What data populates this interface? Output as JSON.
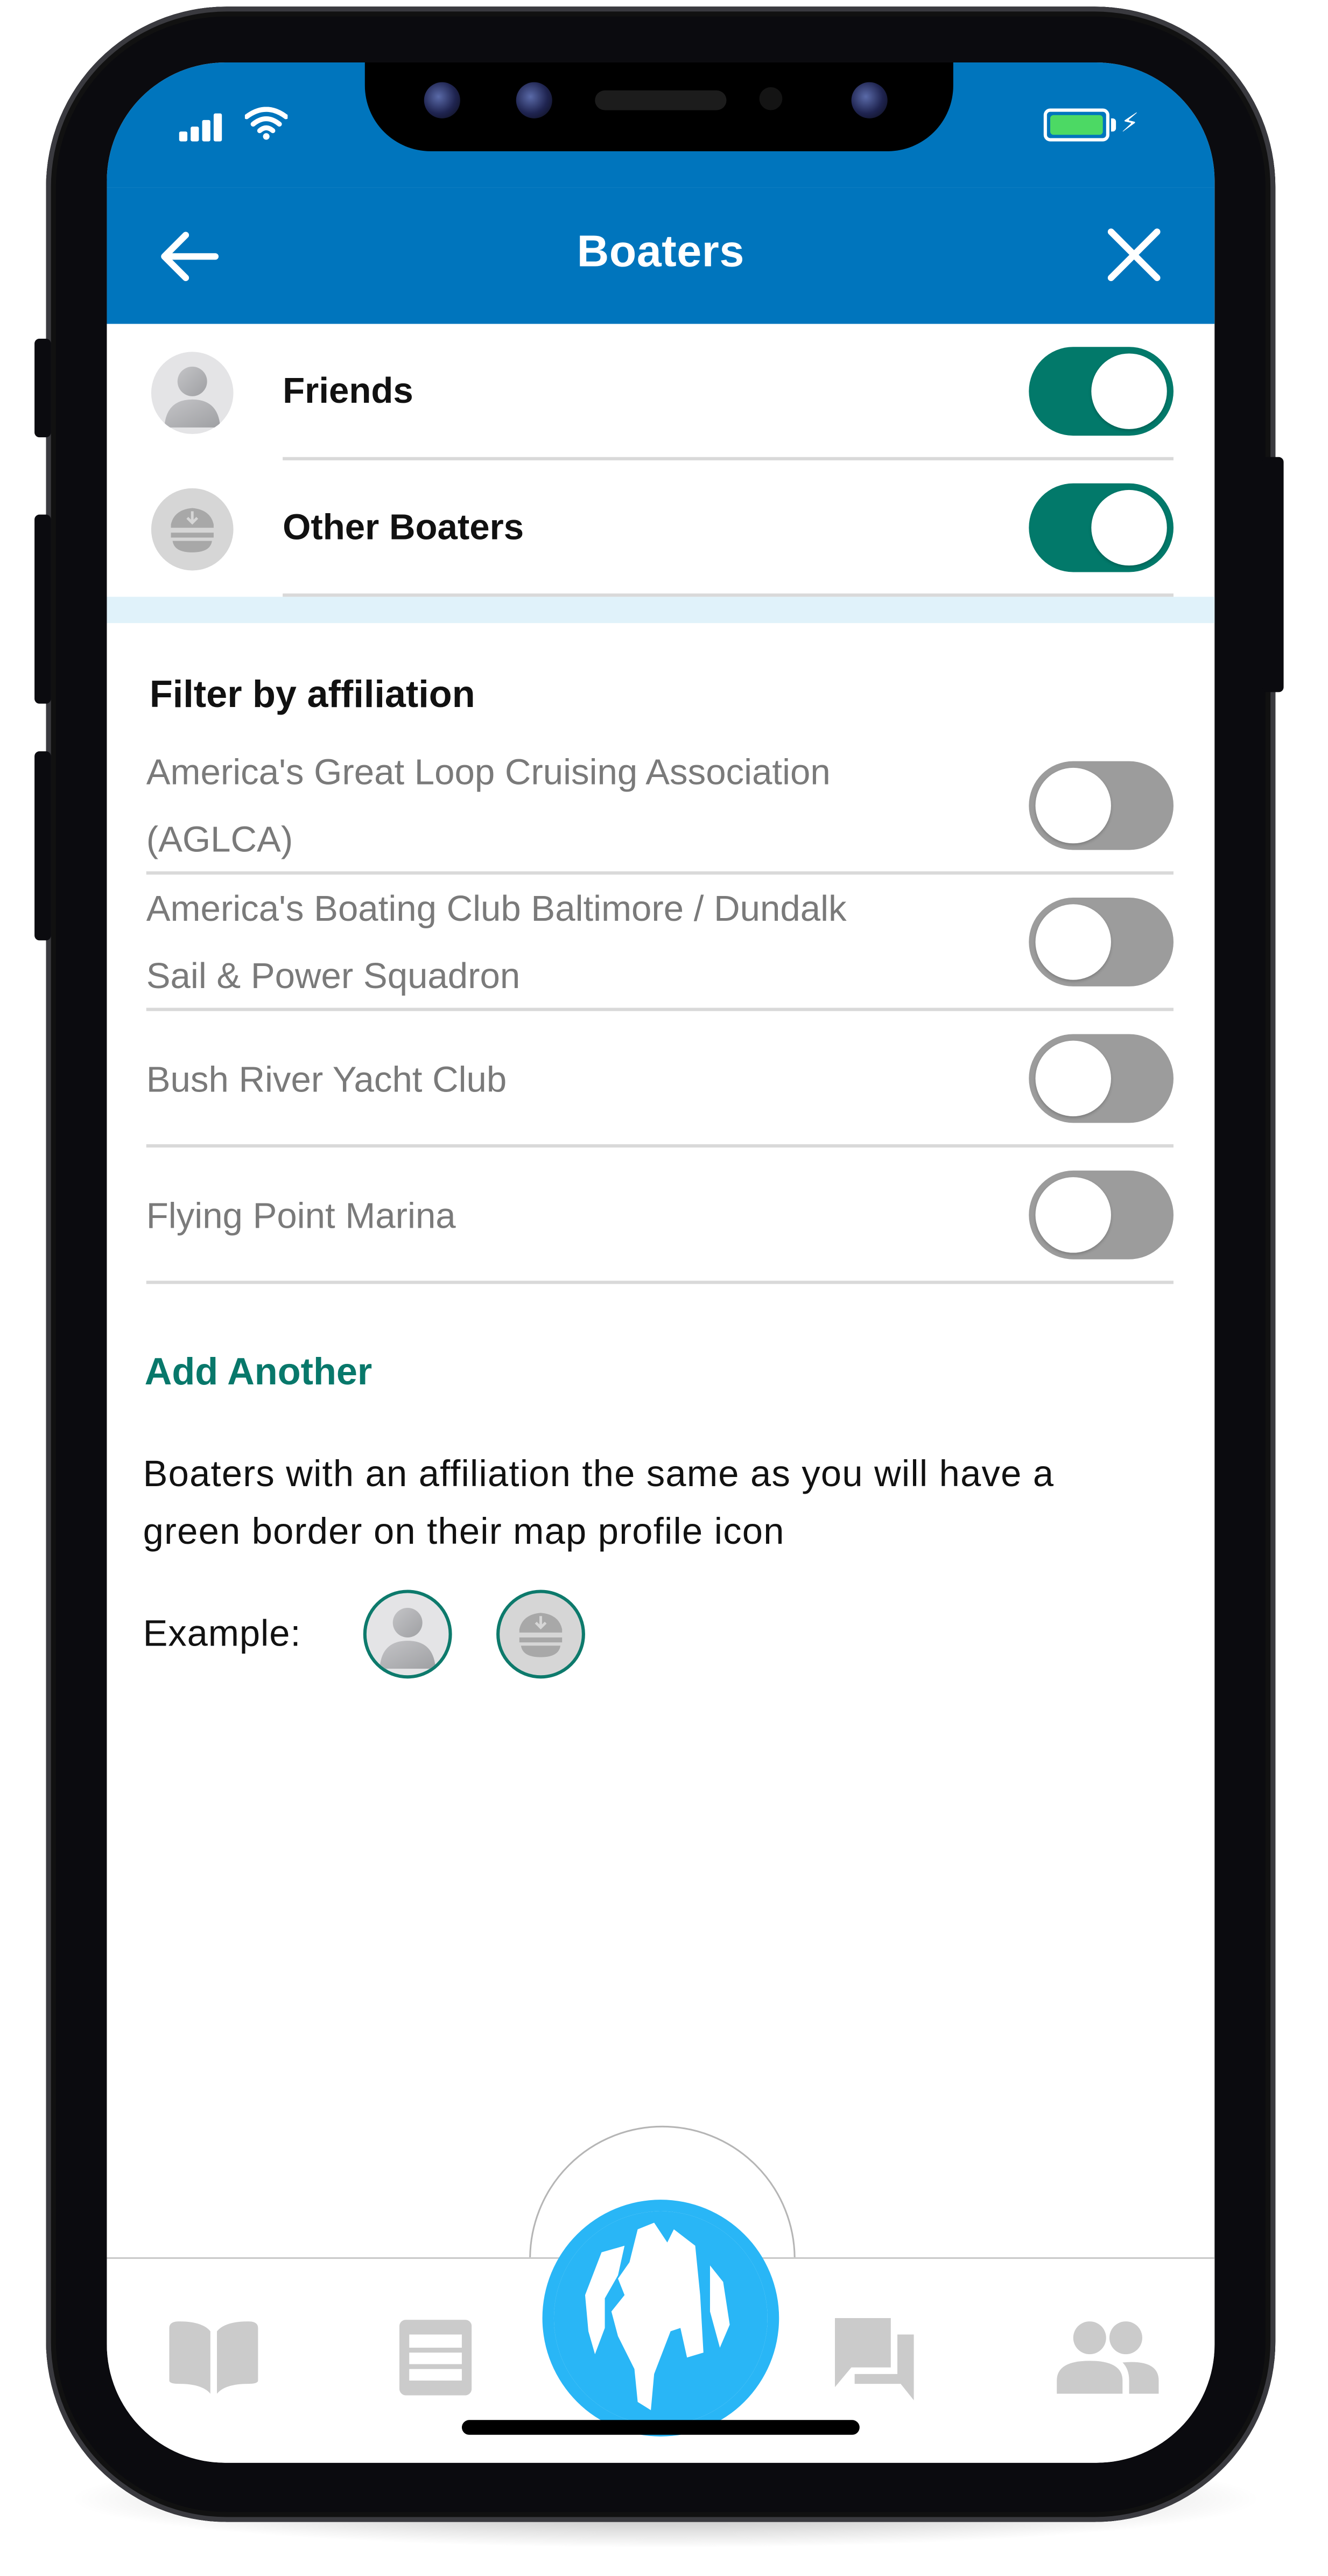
{
  "status_bar": {
    "signal_icon": "cellular-signal-icon",
    "wifi_icon": "wifi-icon",
    "battery_icon": "battery-charging-icon",
    "battery_level_percent": 100
  },
  "header": {
    "title": "Boaters",
    "back_icon": "arrow-left-icon",
    "close_icon": "close-icon",
    "background_color": "#0075bd"
  },
  "visibility": [
    {
      "label": "Friends",
      "icon": "person-avatar-icon",
      "enabled": true
    },
    {
      "label": "Other Boaters",
      "icon": "captain-hat-icon",
      "enabled": true
    }
  ],
  "affiliation": {
    "heading": "Filter by affiliation",
    "items": [
      {
        "line1": "America's Great Loop Cruising Association",
        "line2": "(AGLCA)",
        "enabled": false
      },
      {
        "line1": "America's Boating Club Baltimore / Dundalk",
        "line2": "Sail & Power Squadron",
        "enabled": false
      },
      {
        "line1": "Bush River Yacht Club",
        "line2": "",
        "enabled": false
      },
      {
        "line1": "Flying Point Marina",
        "line2": "",
        "enabled": false
      }
    ],
    "add_another_label": "Add Another",
    "note_line1": "Boaters with an affiliation the same as you will have a",
    "note_line2": "green border on their map profile icon",
    "example_label": "Example:"
  },
  "tab_bar": {
    "items": [
      {
        "name": "logbook",
        "icon": "book-icon",
        "active": false
      },
      {
        "name": "list",
        "icon": "list-icon",
        "active": false
      },
      {
        "name": "map",
        "icon": "globe-icon",
        "active": true
      },
      {
        "name": "messages",
        "icon": "chat-icon",
        "active": false
      },
      {
        "name": "boaters",
        "icon": "people-icon",
        "active": false
      }
    ]
  },
  "colors": {
    "primary_blue": "#0075bd",
    "toggle_on": "#02796a",
    "toggle_off": "#9c9c9c",
    "accent_green": "#08786b",
    "globe_blue": "#29b6f6",
    "tab_icon_gray": "#cbcbcb",
    "section_band": "#e0f2fa"
  }
}
